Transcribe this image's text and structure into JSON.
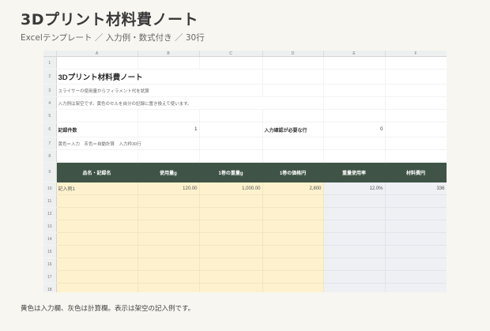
{
  "header": {
    "title": "3Dプリント材料費ノート",
    "subtitle": "Excelテンプレート ／ 入力例・数式付き ／ 30行"
  },
  "sheet": {
    "columns": [
      "A",
      "B",
      "C",
      "D",
      "E",
      "F"
    ],
    "rows": [
      "1",
      "2",
      "3",
      "4",
      "5",
      "6",
      "7",
      "8",
      "9",
      "10",
      "11",
      "12",
      "13",
      "14",
      "15",
      "16",
      "17",
      "18"
    ],
    "title": "3Dプリント材料費ノート",
    "note1": "スライサーの使用量からフィラメント代を試算",
    "note2": "入力例は架空です。黄色のセルを自分の記録に置き換えて使います。",
    "record_count_label": "記録件数",
    "record_count_value": "1",
    "confirm_label": "入力確認が必要な行",
    "confirm_value": "0",
    "legend": "黄色＝入力　灰色＝自動計算　入力枠30行",
    "table_headers": [
      "品名・記録名",
      "使用量g",
      "1巻の重量g",
      "1巻の価格円",
      "重量使用率",
      "材料費円"
    ],
    "example_row": [
      "記入例1",
      "120.00",
      "1,000.00",
      "2,800",
      "12.0%",
      "336"
    ]
  },
  "footer": {
    "note": "黄色は入力欄、灰色は計算欄。表示は架空の記入例です。"
  },
  "colors": {
    "header_fill": "#3f5446",
    "input_fill": "#fdf2cd",
    "calc_fill": "#eef0f4"
  }
}
